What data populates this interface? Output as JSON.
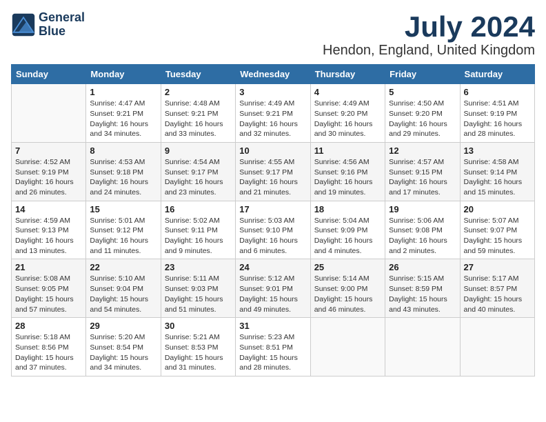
{
  "logo": {
    "line1": "General",
    "line2": "Blue"
  },
  "title": "July 2024",
  "location": "Hendon, England, United Kingdom",
  "days_of_week": [
    "Sunday",
    "Monday",
    "Tuesday",
    "Wednesday",
    "Thursday",
    "Friday",
    "Saturday"
  ],
  "weeks": [
    [
      {
        "day": "",
        "text": ""
      },
      {
        "day": "1",
        "text": "Sunrise: 4:47 AM\nSunset: 9:21 PM\nDaylight: 16 hours\nand 34 minutes."
      },
      {
        "day": "2",
        "text": "Sunrise: 4:48 AM\nSunset: 9:21 PM\nDaylight: 16 hours\nand 33 minutes."
      },
      {
        "day": "3",
        "text": "Sunrise: 4:49 AM\nSunset: 9:21 PM\nDaylight: 16 hours\nand 32 minutes."
      },
      {
        "day": "4",
        "text": "Sunrise: 4:49 AM\nSunset: 9:20 PM\nDaylight: 16 hours\nand 30 minutes."
      },
      {
        "day": "5",
        "text": "Sunrise: 4:50 AM\nSunset: 9:20 PM\nDaylight: 16 hours\nand 29 minutes."
      },
      {
        "day": "6",
        "text": "Sunrise: 4:51 AM\nSunset: 9:19 PM\nDaylight: 16 hours\nand 28 minutes."
      }
    ],
    [
      {
        "day": "7",
        "text": "Sunrise: 4:52 AM\nSunset: 9:19 PM\nDaylight: 16 hours\nand 26 minutes."
      },
      {
        "day": "8",
        "text": "Sunrise: 4:53 AM\nSunset: 9:18 PM\nDaylight: 16 hours\nand 24 minutes."
      },
      {
        "day": "9",
        "text": "Sunrise: 4:54 AM\nSunset: 9:17 PM\nDaylight: 16 hours\nand 23 minutes."
      },
      {
        "day": "10",
        "text": "Sunrise: 4:55 AM\nSunset: 9:17 PM\nDaylight: 16 hours\nand 21 minutes."
      },
      {
        "day": "11",
        "text": "Sunrise: 4:56 AM\nSunset: 9:16 PM\nDaylight: 16 hours\nand 19 minutes."
      },
      {
        "day": "12",
        "text": "Sunrise: 4:57 AM\nSunset: 9:15 PM\nDaylight: 16 hours\nand 17 minutes."
      },
      {
        "day": "13",
        "text": "Sunrise: 4:58 AM\nSunset: 9:14 PM\nDaylight: 16 hours\nand 15 minutes."
      }
    ],
    [
      {
        "day": "14",
        "text": "Sunrise: 4:59 AM\nSunset: 9:13 PM\nDaylight: 16 hours\nand 13 minutes."
      },
      {
        "day": "15",
        "text": "Sunrise: 5:01 AM\nSunset: 9:12 PM\nDaylight: 16 hours\nand 11 minutes."
      },
      {
        "day": "16",
        "text": "Sunrise: 5:02 AM\nSunset: 9:11 PM\nDaylight: 16 hours\nand 9 minutes."
      },
      {
        "day": "17",
        "text": "Sunrise: 5:03 AM\nSunset: 9:10 PM\nDaylight: 16 hours\nand 6 minutes."
      },
      {
        "day": "18",
        "text": "Sunrise: 5:04 AM\nSunset: 9:09 PM\nDaylight: 16 hours\nand 4 minutes."
      },
      {
        "day": "19",
        "text": "Sunrise: 5:06 AM\nSunset: 9:08 PM\nDaylight: 16 hours\nand 2 minutes."
      },
      {
        "day": "20",
        "text": "Sunrise: 5:07 AM\nSunset: 9:07 PM\nDaylight: 15 hours\nand 59 minutes."
      }
    ],
    [
      {
        "day": "21",
        "text": "Sunrise: 5:08 AM\nSunset: 9:05 PM\nDaylight: 15 hours\nand 57 minutes."
      },
      {
        "day": "22",
        "text": "Sunrise: 5:10 AM\nSunset: 9:04 PM\nDaylight: 15 hours\nand 54 minutes."
      },
      {
        "day": "23",
        "text": "Sunrise: 5:11 AM\nSunset: 9:03 PM\nDaylight: 15 hours\nand 51 minutes."
      },
      {
        "day": "24",
        "text": "Sunrise: 5:12 AM\nSunset: 9:01 PM\nDaylight: 15 hours\nand 49 minutes."
      },
      {
        "day": "25",
        "text": "Sunrise: 5:14 AM\nSunset: 9:00 PM\nDaylight: 15 hours\nand 46 minutes."
      },
      {
        "day": "26",
        "text": "Sunrise: 5:15 AM\nSunset: 8:59 PM\nDaylight: 15 hours\nand 43 minutes."
      },
      {
        "day": "27",
        "text": "Sunrise: 5:17 AM\nSunset: 8:57 PM\nDaylight: 15 hours\nand 40 minutes."
      }
    ],
    [
      {
        "day": "28",
        "text": "Sunrise: 5:18 AM\nSunset: 8:56 PM\nDaylight: 15 hours\nand 37 minutes."
      },
      {
        "day": "29",
        "text": "Sunrise: 5:20 AM\nSunset: 8:54 PM\nDaylight: 15 hours\nand 34 minutes."
      },
      {
        "day": "30",
        "text": "Sunrise: 5:21 AM\nSunset: 8:53 PM\nDaylight: 15 hours\nand 31 minutes."
      },
      {
        "day": "31",
        "text": "Sunrise: 5:23 AM\nSunset: 8:51 PM\nDaylight: 15 hours\nand 28 minutes."
      },
      {
        "day": "",
        "text": ""
      },
      {
        "day": "",
        "text": ""
      },
      {
        "day": "",
        "text": ""
      }
    ]
  ]
}
